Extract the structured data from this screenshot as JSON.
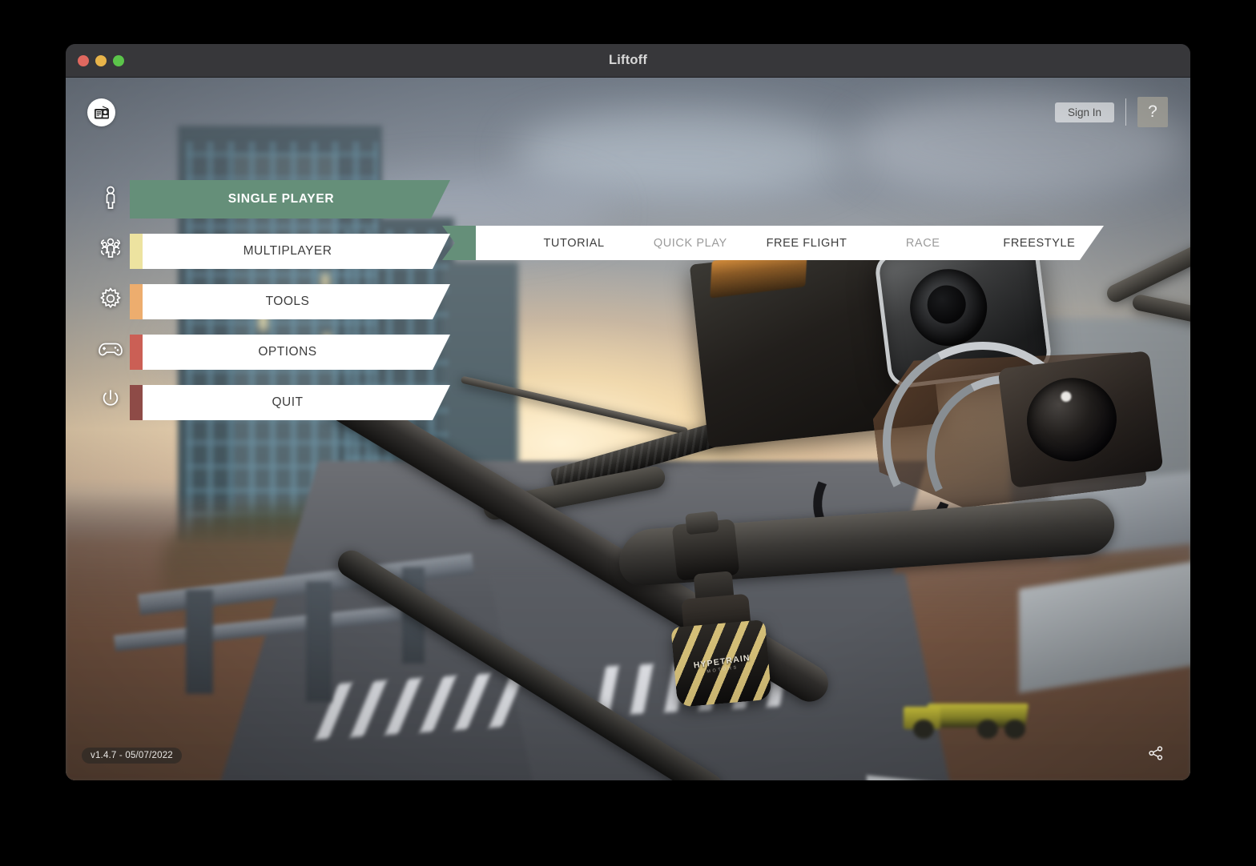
{
  "window": {
    "title": "Liftoff",
    "controls": [
      "close",
      "minimize",
      "maximize"
    ]
  },
  "overlay": {
    "news_icon": "radio-news-icon",
    "sign_in_label": "Sign In",
    "help_label": "?",
    "version_label": "v1.4.7 - 05/07/2022",
    "share_icon": "share-icon"
  },
  "rail": {
    "icons": [
      {
        "name": "single-player-icon",
        "glyph": "person"
      },
      {
        "name": "multiplayer-icon",
        "glyph": "people"
      },
      {
        "name": "tools-icon",
        "glyph": "gear"
      },
      {
        "name": "options-icon",
        "glyph": "gamepad"
      },
      {
        "name": "quit-icon",
        "glyph": "power"
      }
    ]
  },
  "menu": {
    "items": [
      {
        "label": "SINGLE PLAYER",
        "accent": "#658F79",
        "active": true
      },
      {
        "label": "MULTIPLAYER",
        "accent": "#EDE3A0",
        "active": false
      },
      {
        "label": "TOOLS",
        "accent": "#EDAD6E",
        "active": false
      },
      {
        "label": "OPTIONS",
        "accent": "#CB5F55",
        "active": false
      },
      {
        "label": "QUIT",
        "accent": "#8E4B47",
        "active": false
      }
    ]
  },
  "subnav": {
    "items": [
      {
        "label": "TUTORIAL",
        "dim": false
      },
      {
        "label": "QUICK PLAY",
        "dim": true
      },
      {
        "label": "FREE FLIGHT",
        "dim": false
      },
      {
        "label": "RACE",
        "dim": true
      },
      {
        "label": "FREESTYLE",
        "dim": false
      }
    ]
  },
  "scene": {
    "description": "FPV racing drone close-up over blurred construction-site city at sunset",
    "motor_brand": "HYPETRAIN",
    "motor_sub": "MOTORS"
  },
  "colors": {
    "accent_green": "#658F79",
    "titlebar": "#37373A",
    "plate_white": "#FFFFFF",
    "text_dark": "#3D3D3D"
  }
}
